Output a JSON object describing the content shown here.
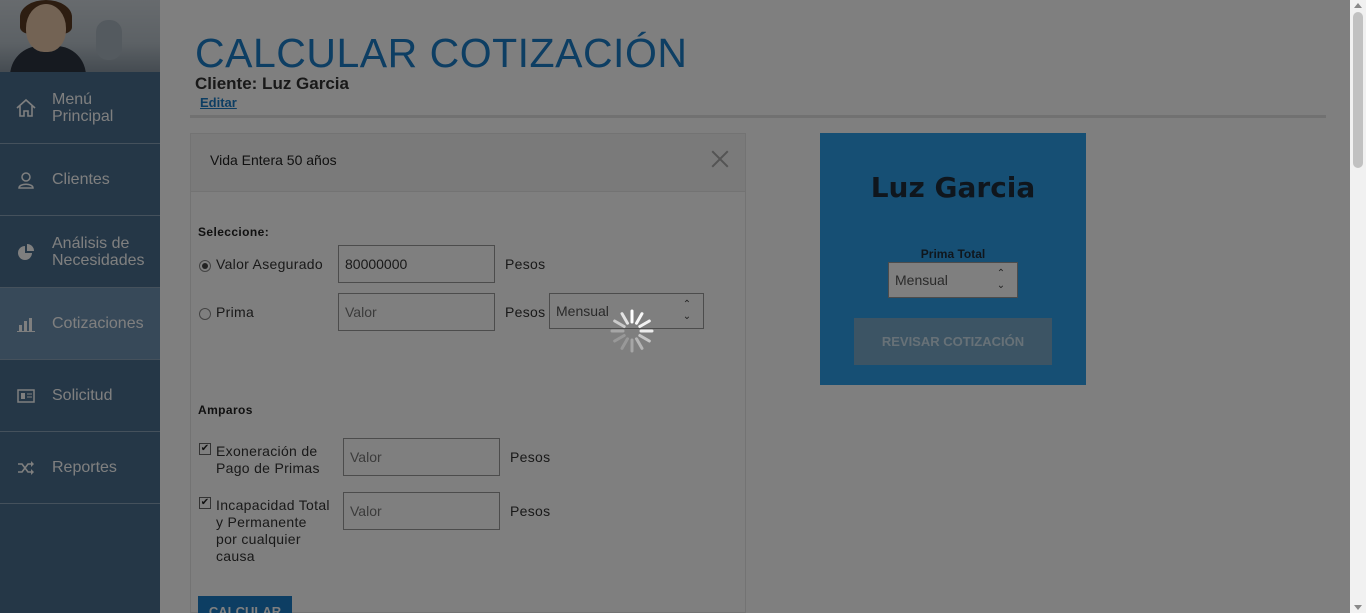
{
  "sidebar": {
    "items": [
      {
        "label": "Menú Principal",
        "icon": "home-icon"
      },
      {
        "label": "Clientes",
        "icon": "user-icon"
      },
      {
        "label": "Análisis de Necesidades",
        "icon": "pie-chart-icon"
      },
      {
        "label": "Cotizaciones",
        "icon": "bar-chart-icon",
        "active": true
      },
      {
        "label": "Solicitud",
        "icon": "form-icon"
      },
      {
        "label": "Reportes",
        "icon": "shuffle-icon"
      }
    ]
  },
  "header": {
    "title": "CALCULAR COTIZACIÓN",
    "client": "Cliente: Luz Garcia",
    "edit_link": "Editar"
  },
  "panel": {
    "title": "Vida Entera 50 años",
    "select_label": "Seleccione:",
    "valor_asegurado": {
      "label": "Valor Asegurado",
      "value": "80000000",
      "unit": "Pesos",
      "selected": true
    },
    "prima": {
      "label": "Prima",
      "placeholder": "Valor",
      "unit": "Pesos",
      "frequency": "Mensual",
      "selected": false
    },
    "amparos_label": "Amparos",
    "amparos": [
      {
        "label_line1": "Exoneración de",
        "label_line2": "Pago de Primas",
        "placeholder": "Valor",
        "unit": "Pesos",
        "checked": true
      },
      {
        "label_line1": "Incapacidad Total",
        "label_line2": "y Permanente",
        "label_line3": "por cualquier",
        "label_line4": "causa",
        "placeholder": "Valor",
        "unit": "Pesos",
        "checked": true
      }
    ],
    "calc_button": "CALCULAR"
  },
  "summary": {
    "client_name": "Luz Garcia",
    "prima_total_label": "Prima Total",
    "frequency": "Mensual",
    "review_button": "REVISAR COTIZACIÓN"
  },
  "colors": {
    "accent": "#1b7cc7",
    "sidebar": "#4a6f8f",
    "summary_bg": "#2d9ee8"
  }
}
